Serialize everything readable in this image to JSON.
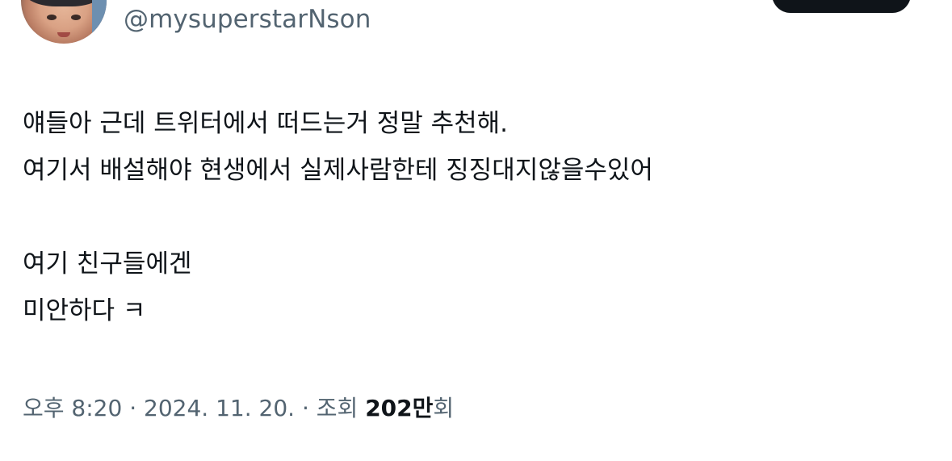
{
  "profile": {
    "handle": "@mysuperstarNson"
  },
  "tweet": {
    "lines": [
      "얘들아 근데 트위터에서 떠드는거 정말 추천해.",
      "여기서 배설해야 현생에서 실제사람한테 징징대지않을수있어",
      "여기 친구들에겐",
      "미안하다 ㅋ"
    ]
  },
  "meta": {
    "time": "오후 8:20",
    "separator": " · ",
    "date": "2024. 11. 20.",
    "views_label": "조회",
    "views_count": "202만",
    "views_suffix": "회"
  }
}
